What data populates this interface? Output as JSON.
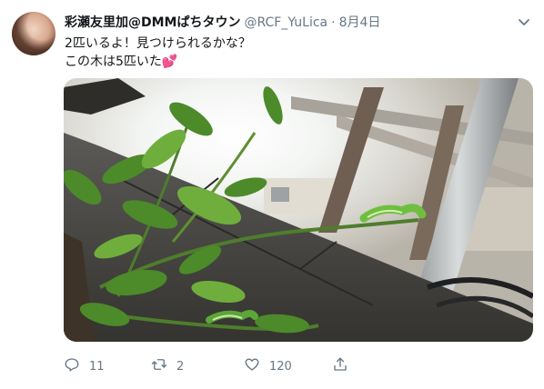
{
  "tweet": {
    "display_name": "彩瀬友里加@DMMぱちタウン",
    "handle": "@RCF_YuLica",
    "separator": "·",
    "date": "8月4日",
    "text_line1": "2匹いるよ！見つけられるかな？",
    "text_line2": "この木は5匹いた",
    "text_emoji": "💕",
    "menu_icon": "chevron-down-icon",
    "media_subject": "caterpillars-on-citrus-tree-photo"
  },
  "actions": {
    "reply_count": "11",
    "retweet_count": "2",
    "like_count": "120",
    "icons": [
      "reply-icon",
      "retweet-icon",
      "like-icon",
      "share-icon"
    ]
  },
  "colors": {
    "text": "#14171a",
    "secondary": "#657786",
    "heart": "#e0245e"
  }
}
